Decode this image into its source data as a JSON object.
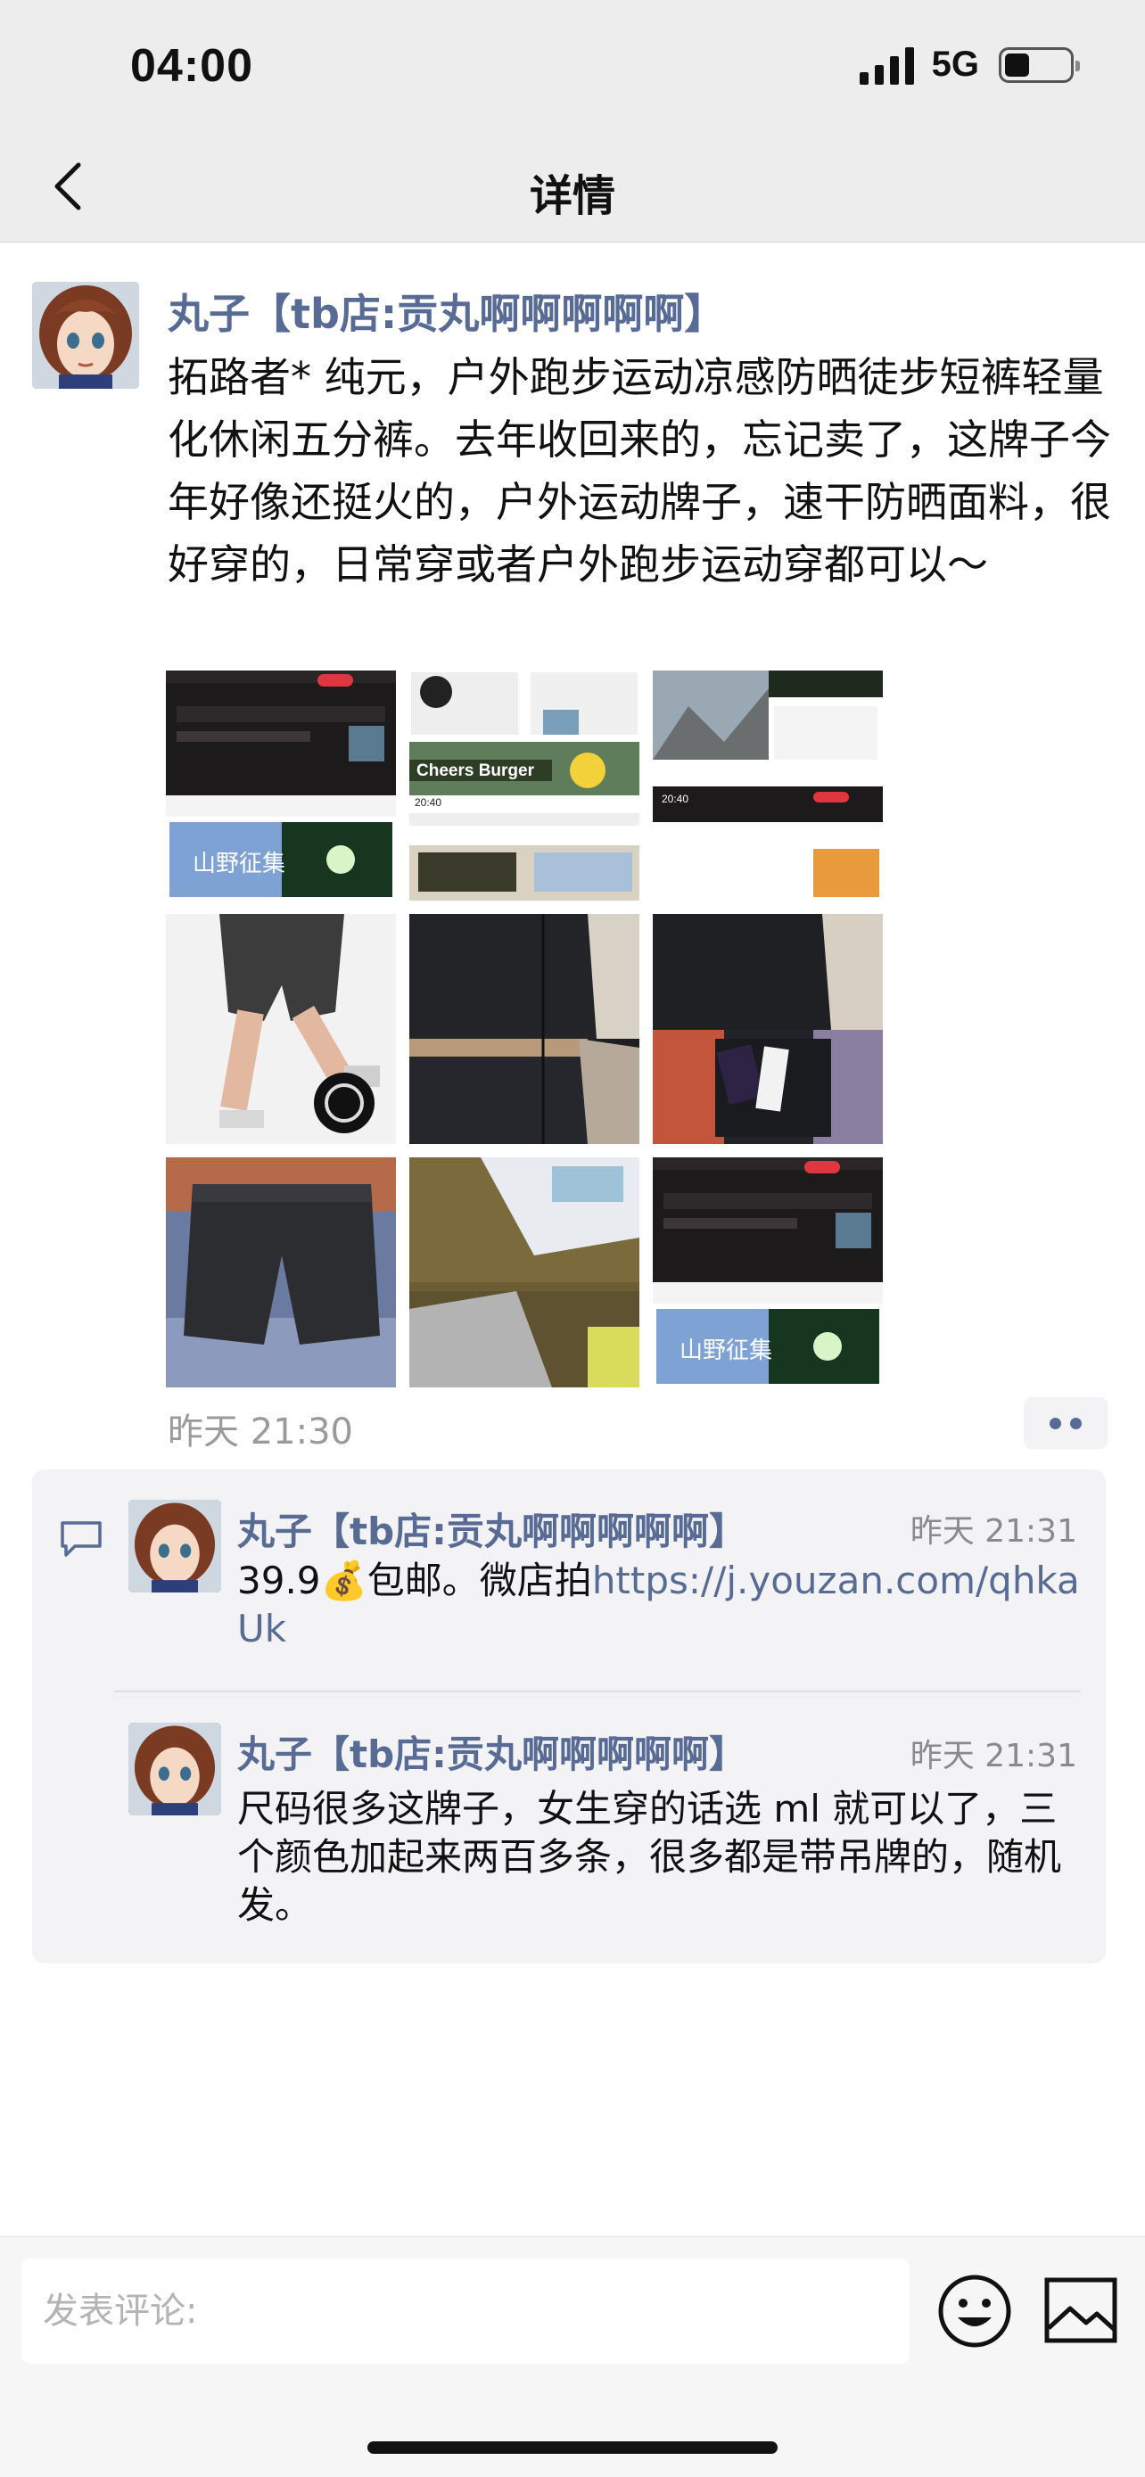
{
  "status_bar": {
    "time": "04:00",
    "network": "5G"
  },
  "nav": {
    "title": "详情"
  },
  "post": {
    "author": "丸子【tb店:贡丸啊啊啊啊啊】",
    "text": "拓路者* 纯元，户外跑步运动凉感防晒徒步短裤轻量化休闲五分裤。去年收回来的，忘记卖了，这牌子今年好像还挺火的，户外运动牌子，速干防晒面料，很好穿的，日常穿或者户外跑步运动穿都可以～",
    "time": "昨天 21:30",
    "images": [
      {
        "type": "screenshot-app",
        "banner": "山野征集"
      },
      {
        "type": "screenshot-feed",
        "banner": "Cheers Burger",
        "clock": "20:40"
      },
      {
        "type": "screenshot-mountain",
        "clock": "20:40"
      },
      {
        "type": "photo-model"
      },
      {
        "type": "photo-fabric"
      },
      {
        "type": "photo-tag"
      },
      {
        "type": "photo-shorts"
      },
      {
        "type": "photo-label"
      },
      {
        "type": "screenshot-app",
        "banner": "山野征集"
      }
    ]
  },
  "comments": [
    {
      "author": "丸子【tb店:贡丸啊啊啊啊啊】",
      "time": "昨天 21:31",
      "text_before": "39.9💰包邮。微店拍",
      "link": "https://j.youzan.com/qhkaUk"
    },
    {
      "author": "丸子【tb店:贡丸啊啊啊啊啊】",
      "time": "昨天 21:31",
      "text": "尺码很多这牌子，女生穿的话选 ml 就可以了，三个颜色加起来两百多条，很多都是带吊牌的，随机发。"
    }
  ],
  "input": {
    "placeholder": "发表评论:"
  },
  "colors": {
    "link": "#576b95",
    "bar_bg": "#ededed",
    "comment_bg": "#f3f3f5"
  }
}
